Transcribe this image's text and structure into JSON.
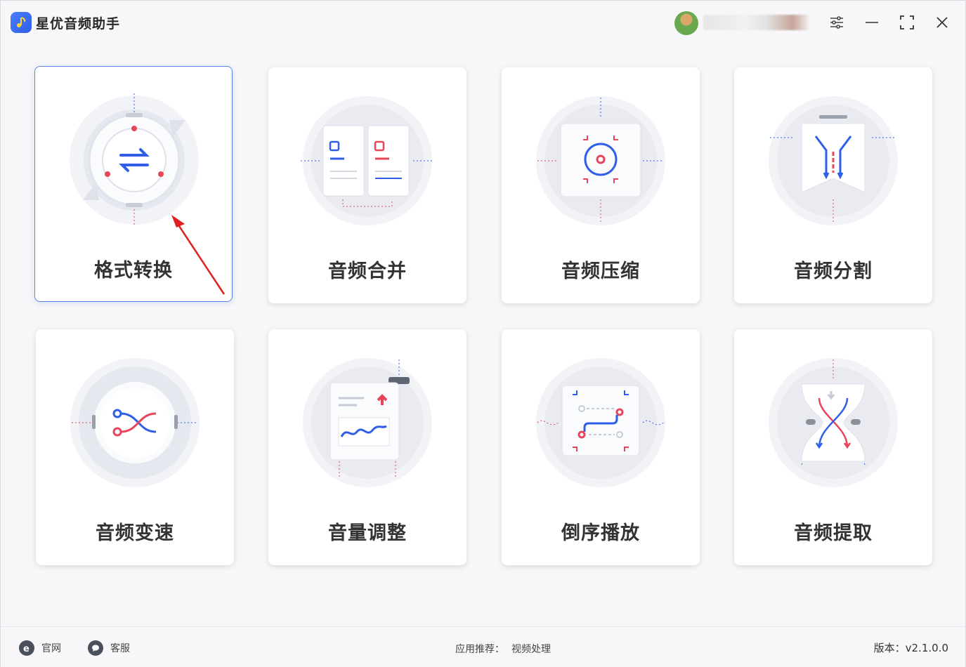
{
  "app": {
    "title": "星优音频助手"
  },
  "titlebar": {
    "icons": [
      "settings-sliders-icon",
      "minimize-icon",
      "maximize-icon",
      "close-icon"
    ]
  },
  "tools": [
    {
      "label": "格式转换",
      "icon": "format-convert-icon",
      "selected": true
    },
    {
      "label": "音频合并",
      "icon": "audio-merge-icon",
      "selected": false
    },
    {
      "label": "音频压缩",
      "icon": "audio-compress-icon",
      "selected": false
    },
    {
      "label": "音频分割",
      "icon": "audio-split-icon",
      "selected": false
    },
    {
      "label": "音频变速",
      "icon": "audio-speed-icon",
      "selected": false
    },
    {
      "label": "音量调整",
      "icon": "volume-adjust-icon",
      "selected": false
    },
    {
      "label": "倒序播放",
      "icon": "reverse-play-icon",
      "selected": false
    },
    {
      "label": "音频提取",
      "icon": "audio-extract-icon",
      "selected": false
    }
  ],
  "footer": {
    "website": "官网",
    "support": "客服",
    "recommend_label": "应用推荐：",
    "recommend_link": "视频处理",
    "version": "版本：v2.1.0.0"
  },
  "colors": {
    "accent_blue": "#2f5fe8",
    "accent_red": "#e8455a",
    "selected_border": "#5a83e6"
  }
}
